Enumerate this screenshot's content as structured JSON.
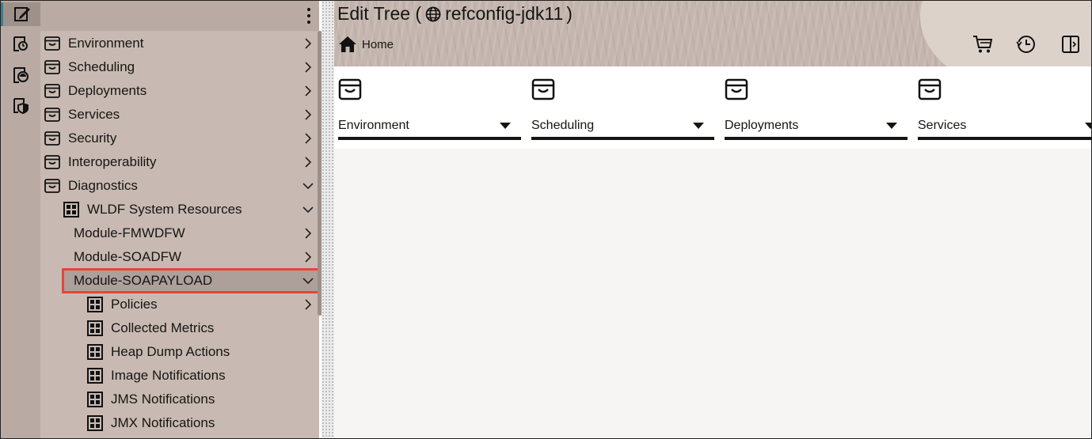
{
  "rail": {
    "items": [
      {
        "icon": "edit-icon",
        "active": true
      },
      {
        "icon": "monitoring-icon",
        "active": false
      },
      {
        "icon": "configuration-icon",
        "active": false
      },
      {
        "icon": "security-shield-icon",
        "active": false
      }
    ]
  },
  "tree": {
    "items": [
      {
        "label": "Environment",
        "icon": "folder-icon",
        "chevron": "right"
      },
      {
        "label": "Scheduling",
        "icon": "folder-icon",
        "chevron": "right"
      },
      {
        "label": "Deployments",
        "icon": "folder-icon",
        "chevron": "right"
      },
      {
        "label": "Services",
        "icon": "folder-icon",
        "chevron": "right"
      },
      {
        "label": "Security",
        "icon": "folder-icon",
        "chevron": "right"
      },
      {
        "label": "Interoperability",
        "icon": "folder-icon",
        "chevron": "right"
      },
      {
        "label": "Diagnostics",
        "icon": "folder-icon",
        "chevron": "down"
      },
      {
        "label": "WLDF System Resources",
        "icon": "grid-icon",
        "chevron": "down"
      },
      {
        "label": "Module-FMWDFW",
        "icon": "",
        "chevron": "right"
      },
      {
        "label": "Module-SOADFW",
        "icon": "",
        "chevron": "right"
      },
      {
        "label": "Module-SOAPAYLOAD",
        "icon": "",
        "chevron": "down",
        "selected": true
      },
      {
        "label": "Policies",
        "icon": "grid-icon",
        "chevron": "right"
      },
      {
        "label": "Collected Metrics",
        "icon": "grid-icon",
        "chevron": ""
      },
      {
        "label": "Heap Dump Actions",
        "icon": "grid-icon",
        "chevron": ""
      },
      {
        "label": "Image Notifications",
        "icon": "grid-icon",
        "chevron": ""
      },
      {
        "label": "JMS Notifications",
        "icon": "grid-icon",
        "chevron": ""
      },
      {
        "label": "JMX Notifications",
        "icon": "grid-icon",
        "chevron": ""
      }
    ]
  },
  "header": {
    "title_prefix": "Edit Tree (",
    "title_name": "refconfig-jdk11",
    "title_suffix": ")",
    "breadcrumb_home": "Home"
  },
  "cards": [
    {
      "label": "Environment"
    },
    {
      "label": "Scheduling"
    },
    {
      "label": "Deployments"
    },
    {
      "label": "Services"
    }
  ],
  "colors": {
    "selection_outline": "#e8443a",
    "rail_active_bar": "#3f7d8a"
  }
}
